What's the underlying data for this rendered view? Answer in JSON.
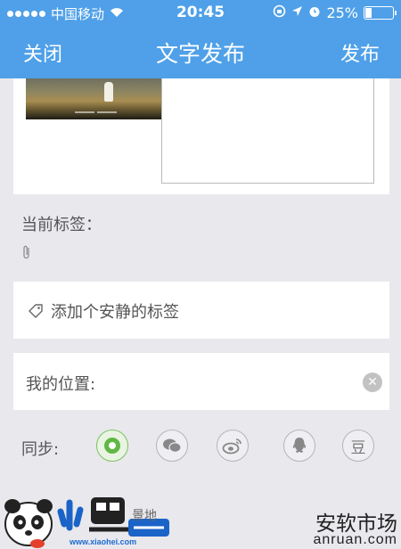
{
  "status_bar": {
    "carrier": "中国移动",
    "time": "20:45",
    "battery": "25%",
    "battery_level": 0.25
  },
  "nav": {
    "close": "关闭",
    "title": "文字发布",
    "publish": "发布"
  },
  "tags": {
    "current_label": "当前标签：",
    "add_prompt": "添加个安静的标签"
  },
  "location": {
    "label": "我的位置:"
  },
  "sync": {
    "label": "同步:",
    "douban_glyph": "豆"
  },
  "watermark": {
    "site": "www.xiaohei.com",
    "residual": "景地",
    "store_cn": "安软市场",
    "store_en": "anruan.com"
  },
  "colors": {
    "accent": "#4fa0e8",
    "moments_green": "#5fb842"
  }
}
